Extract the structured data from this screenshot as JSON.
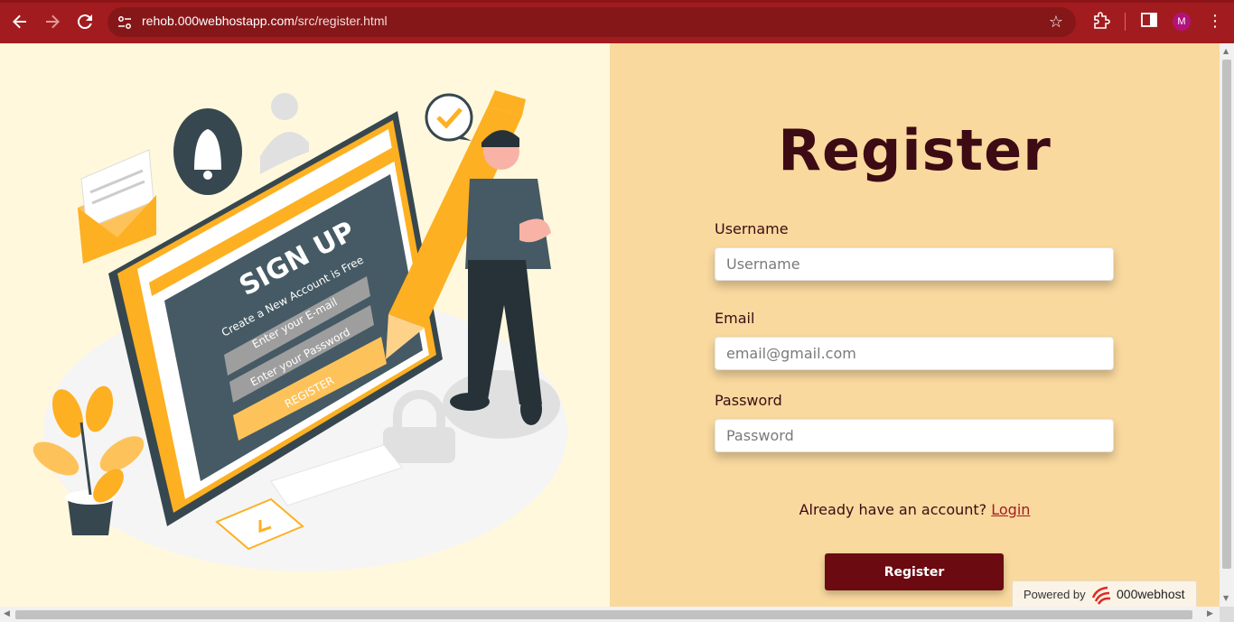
{
  "browser": {
    "url_host": "rehob.000webhostapp.com",
    "url_path": "/src/register.html",
    "avatar_initial": "M",
    "theme_color": "#a21c1f"
  },
  "illustration": {
    "heading": "SIGN UP",
    "subheading": "Create a New Account is Free",
    "email_placeholder": "Enter your E-mail",
    "password_placeholder": "Enter your Password",
    "button": "REGISTER"
  },
  "form": {
    "title": "Register",
    "username_label": "Username",
    "username_placeholder": "Username",
    "email_label": "Email",
    "email_placeholder": "email@gmail.com",
    "password_label": "Password",
    "password_placeholder": "Password",
    "account_prompt": "Already have an account?",
    "login_link": "Login",
    "submit_label": "Register"
  },
  "badge": {
    "powered_text": "Powered by",
    "brand": "000webhost"
  },
  "colors": {
    "left_bg": "#fff8dc",
    "right_bg": "#f9d99e",
    "title": "#3d0b14",
    "button": "#6b0a10",
    "accent_orange": "#fdb022"
  }
}
